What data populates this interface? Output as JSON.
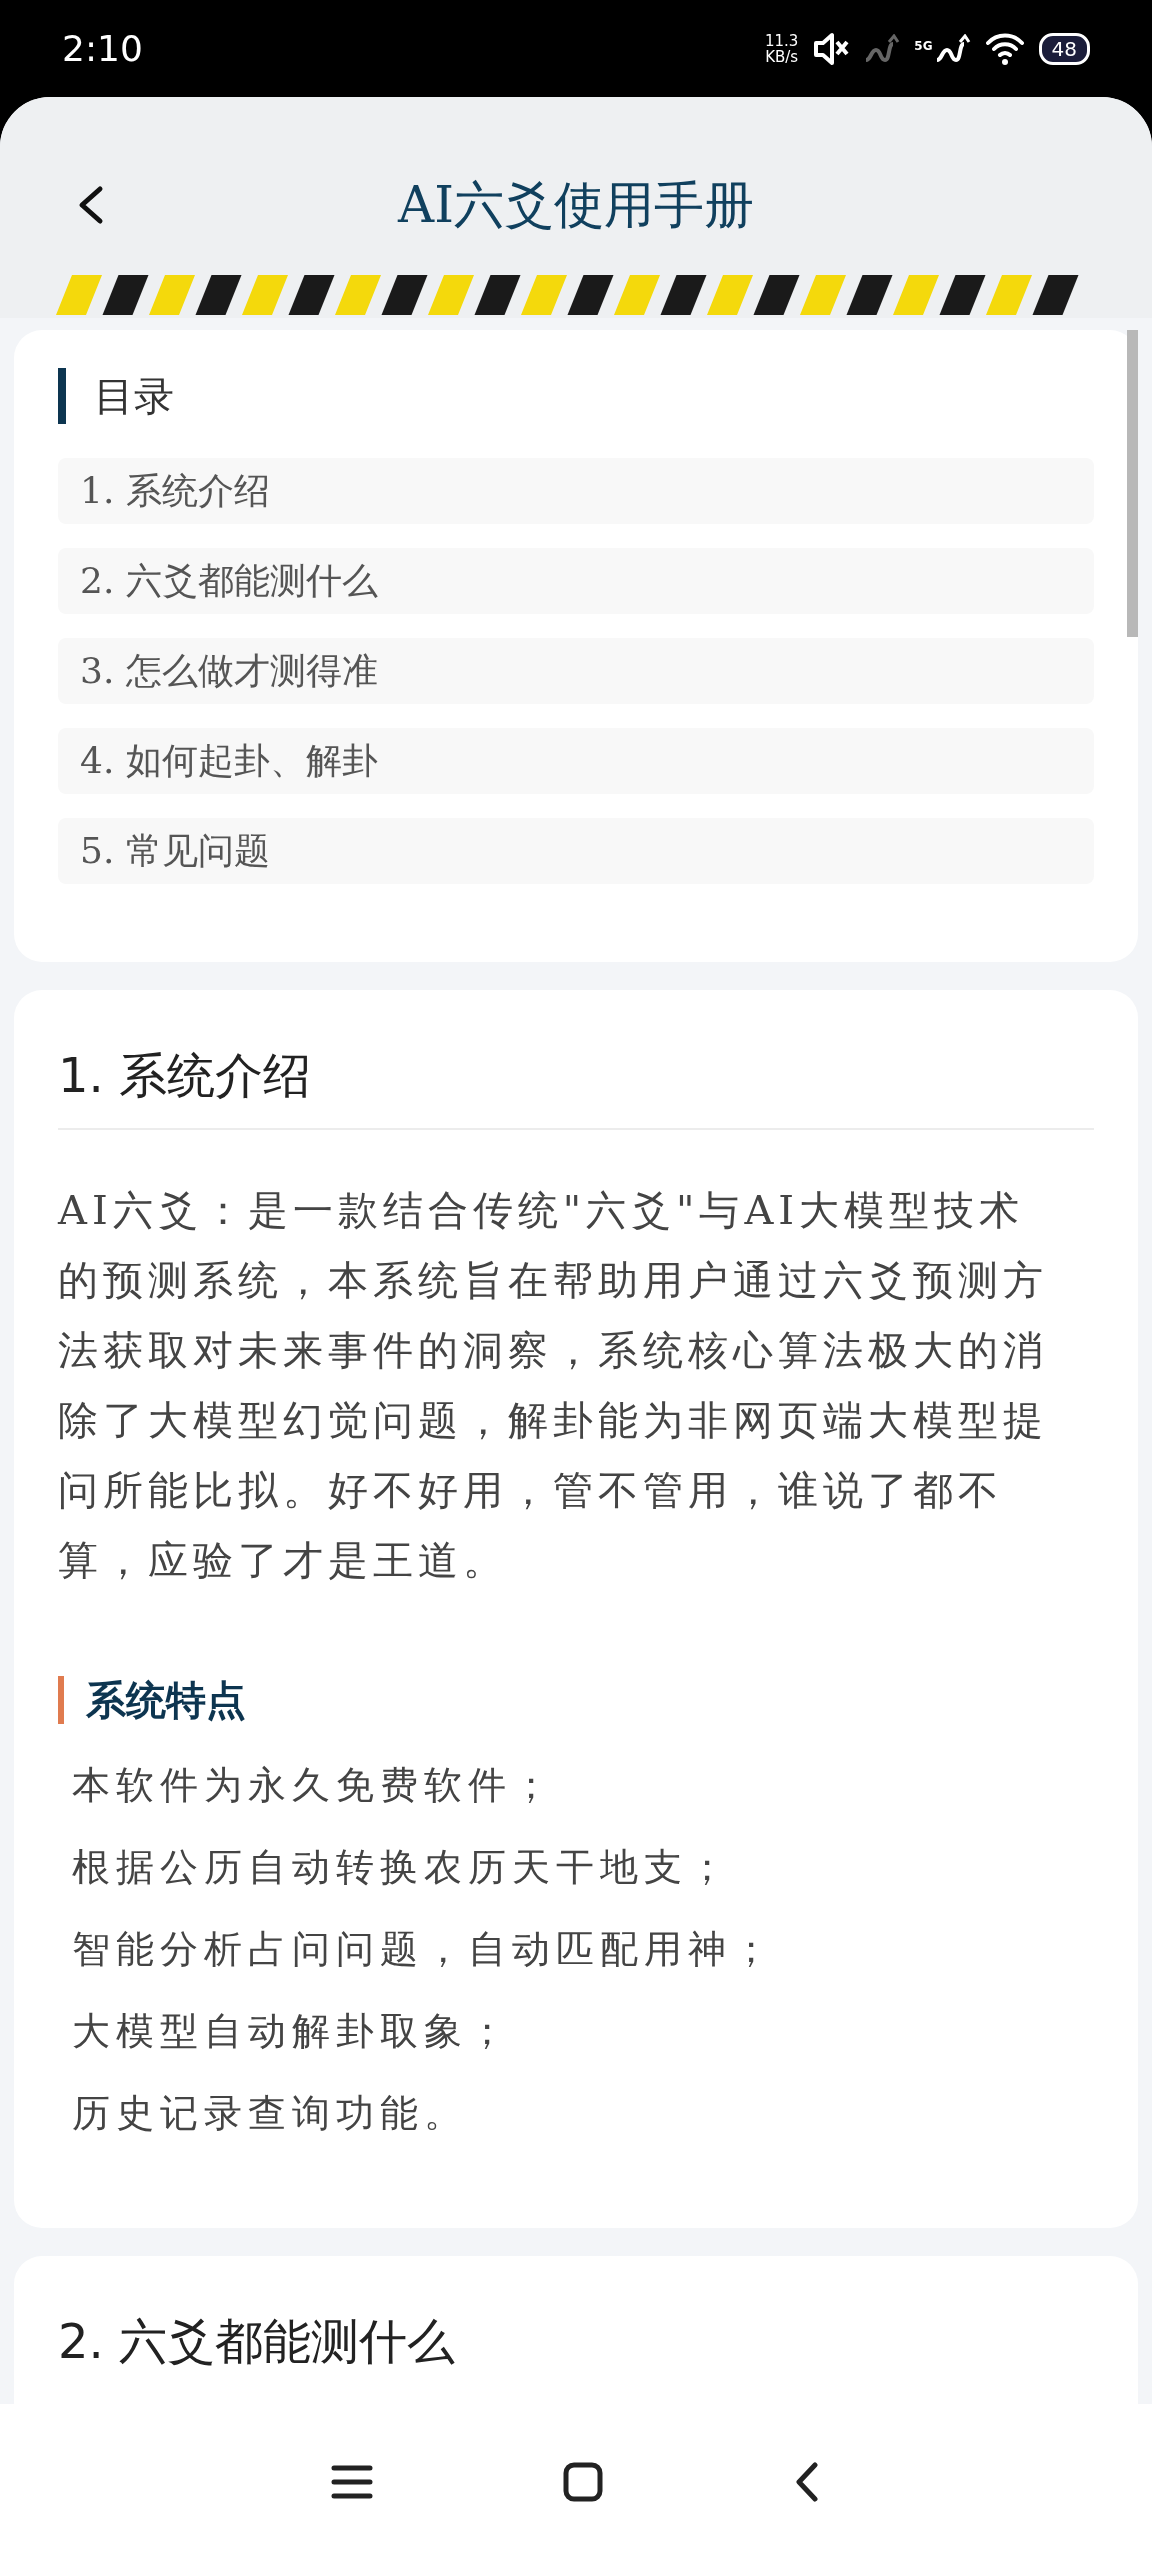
{
  "status_bar": {
    "time": "2:10",
    "net_speed": [
      "11.3",
      "KB/s"
    ],
    "network_type": "5G",
    "battery": "48"
  },
  "header": {
    "title": "AI六爻使用手册"
  },
  "toc": {
    "title": "目录",
    "items": [
      "1. 系统介绍",
      "2. 六爻都能测什么",
      "3. 怎么做才测得准",
      "4. 如何起卦、解卦",
      "5. 常见问题"
    ]
  },
  "sections": [
    {
      "heading": "1. 系统介绍",
      "paragraph": "AI六爻：是一款结合传统\"六爻\"与AI大模型技术的预测系统，本系统旨在帮助用户通过六爻预测方法获取对未来事件的洞察，系统核心算法极大的消除了大模型幻觉问题，解卦能为非网页端大模型提问所能比拟。好不好用，管不管用，谁说了都不算，应验了才是王道。",
      "subsections": [
        {
          "heading": "系统特点",
          "items": [
            "本软件为永久免费软件；",
            "根据公历自动转换农历天干地支；",
            "智能分析占问问题，自动匹配用神；",
            "大模型自动解卦取象；",
            "历史记录查询功能。"
          ]
        }
      ]
    },
    {
      "heading": "2. 六爻都能测什么"
    }
  ]
}
